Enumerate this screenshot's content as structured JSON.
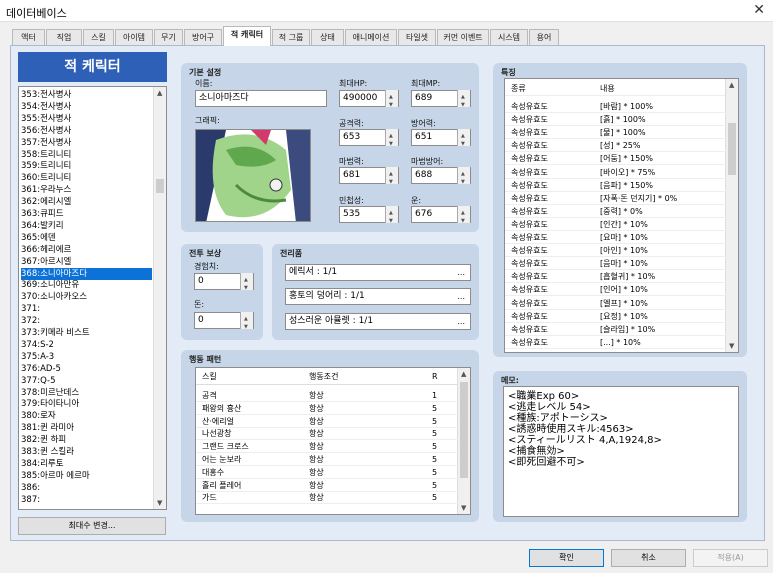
{
  "window": {
    "title": "데이터베이스",
    "close": "✕"
  },
  "tabs": [
    "액터",
    "직업",
    "스킬",
    "아이템",
    "무기",
    "방어구",
    "적 캐릭터",
    "적 그룹",
    "상태",
    "애니메이션",
    "타일셋",
    "커먼 이벤트",
    "시스템",
    "용어"
  ],
  "active_tab": 6,
  "left": {
    "title": "적 케릭터",
    "items": [
      "353:전사병사",
      "354:전사병사",
      "355:전사병사",
      "356:전사병사",
      "357:전사병사",
      "358:트리니티",
      "359:트리니티",
      "360:트리니티",
      "361:우라누스",
      "362:에리시엘",
      "363:큐피드",
      "364:발키리",
      "365:에덴",
      "366:헤리에르",
      "367:아르시엘",
      "368:소니아마즈다",
      "369:소니아만유",
      "370:소니아카오스",
      "371:",
      "372:",
      "373:키메라 비스트",
      "374:S-2",
      "375:A-3",
      "376:AD-5",
      "377:Q-5",
      "378:미르난데스",
      "379:타이타니아",
      "380:로자",
      "381:퀸 라미아",
      "382:퀸 하피",
      "383:퀸 스킬라",
      "384:리루토",
      "385:아르마 에르마",
      "386:",
      "387:"
    ],
    "selected": 15,
    "max_button": "최대수 변경..."
  },
  "basic": {
    "section": "기본 설정",
    "name_label": "이름:",
    "name": "소니아마즈다",
    "graphic_label": "그래픽:",
    "maxhp_label": "최대HP:",
    "maxhp": "490000",
    "maxmp_label": "최대MP:",
    "maxmp": "689",
    "atk_label": "공격력:",
    "atk": "653",
    "def_label": "방어력:",
    "def": "651",
    "mat_label": "마법력:",
    "mat": "681",
    "mdf_label": "마법방어:",
    "mdf": "688",
    "agi_label": "민첩성:",
    "agi": "535",
    "luk_label": "운:",
    "luk": "676"
  },
  "reward": {
    "section": "전투 보상",
    "exp_label": "경험치:",
    "exp": "0",
    "gold_label": "돈:",
    "gold": "0"
  },
  "drops": {
    "section": "전리품",
    "items": [
      "에릭서 : 1/1",
      "홍토의 덩어리 : 1/1",
      "성스러운 아뮬렛 : 1/1"
    ],
    "more": "..."
  },
  "actions": {
    "section": "행동 패턴",
    "headers": [
      "스킬",
      "행동조건",
      "R"
    ],
    "rows": [
      [
        "공격",
        "항상",
        "1"
      ],
      [
        "패왕의 흉산",
        "항상",
        "5"
      ],
      [
        "산·에리얼",
        "항상",
        "5"
      ],
      [
        "나선광창",
        "항상",
        "5"
      ],
      [
        "그랜드 크로스",
        "항상",
        "5"
      ],
      [
        "어는 눈보라",
        "항상",
        "5"
      ],
      [
        "대홍수",
        "항상",
        "5"
      ],
      [
        "홀리 플레어",
        "항상",
        "5"
      ],
      [
        "가드",
        "항상",
        "5"
      ]
    ]
  },
  "traits": {
    "section": "특징",
    "headers": [
      "종류",
      "내용"
    ],
    "rows": [
      [
        "속성유효도",
        "[바람] * 100%"
      ],
      [
        "속성유효도",
        "[흙] * 100%"
      ],
      [
        "속성유효도",
        "[물] * 100%"
      ],
      [
        "속성유효도",
        "[성] * 25%"
      ],
      [
        "속성유효도",
        "[어둠] * 150%"
      ],
      [
        "속성유효도",
        "[바이오] * 75%"
      ],
      [
        "속성유효도",
        "[음파] * 150%"
      ],
      [
        "속성유효도",
        "[자폭·돈 던지기] * 0%"
      ],
      [
        "속성유효도",
        "[중력] * 0%"
      ],
      [
        "속성유효도",
        "[인간] * 10%"
      ],
      [
        "속성유효도",
        "[요마] * 10%"
      ],
      [
        "속성유효도",
        "[아인] * 10%"
      ],
      [
        "속성유효도",
        "[음마] * 10%"
      ],
      [
        "속성유효도",
        "[흡혈귀] * 10%"
      ],
      [
        "속성유효도",
        "[인어] * 10%"
      ],
      [
        "속성유효도",
        "[엘프] * 10%"
      ],
      [
        "속성유효도",
        "[요정] * 10%"
      ],
      [
        "속성유효도",
        "[슬라임] * 10%"
      ],
      [
        "속성유효도",
        "[...] * 10%"
      ]
    ]
  },
  "memo": {
    "section": "메모:",
    "lines": [
      "<職業Exp 60>",
      "<逃走レベル 54>",
      "<種族:アポトーシス>",
      "<誘惑時使用スキル:4563>",
      "<スティールリスト 4,A,1924,8>",
      "<捕食無効>",
      "<即死回避不可>"
    ]
  },
  "buttons": {
    "ok": "확인",
    "cancel": "취소",
    "apply": "적용(A)"
  }
}
